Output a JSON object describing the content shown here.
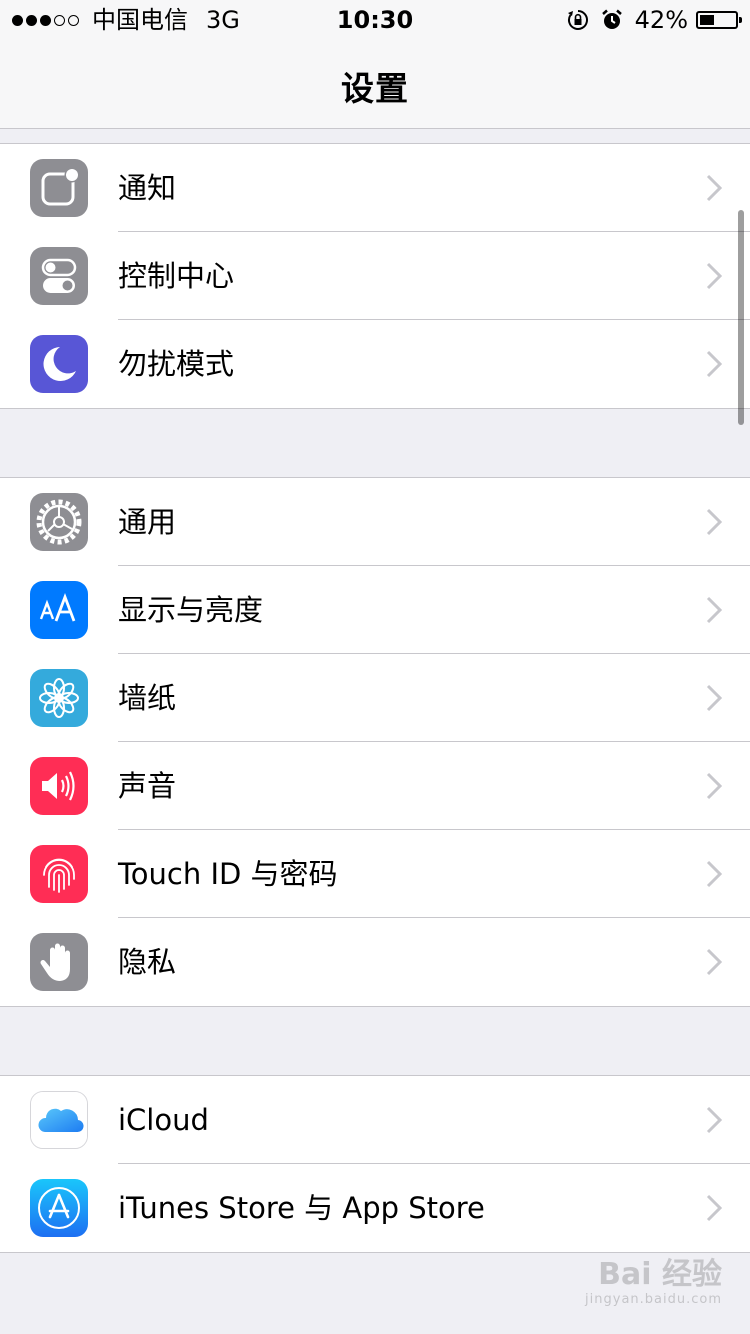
{
  "status_bar": {
    "carrier": "中国电信",
    "network": "3G",
    "time": "10:30",
    "battery_percent": "42%",
    "battery_level": 0.42
  },
  "nav": {
    "title": "设置"
  },
  "groups": [
    {
      "items": [
        {
          "label": "通知",
          "icon": "notifications-icon",
          "color": "#8e8e93"
        },
        {
          "label": "控制中心",
          "icon": "control-center-icon",
          "color": "#8e8e93"
        },
        {
          "label": "勿扰模式",
          "icon": "moon-icon",
          "color": "#5856d6"
        }
      ]
    },
    {
      "items": [
        {
          "label": "通用",
          "icon": "gear-icon",
          "color": "#8e8e93"
        },
        {
          "label": "显示与亮度",
          "icon": "display-text-icon",
          "color": "#007aff"
        },
        {
          "label": "墙纸",
          "icon": "flower-icon",
          "color": "#34aadc"
        },
        {
          "label": "声音",
          "icon": "speaker-icon",
          "color": "#ff2d55"
        },
        {
          "label": "Touch ID 与密码",
          "icon": "fingerprint-icon",
          "color": "#ff2d55"
        },
        {
          "label": "隐私",
          "icon": "hand-icon",
          "color": "#8e8e93"
        }
      ]
    },
    {
      "items": [
        {
          "label": "iCloud",
          "icon": "cloud-icon",
          "color": "#ffffff"
        },
        {
          "label": "iTunes Store 与 App Store",
          "icon": "app-store-icon",
          "color": "#1b8ff5"
        }
      ]
    }
  ],
  "watermark": {
    "brand": "Bai 经验",
    "url": "jingyan.baidu.com"
  }
}
